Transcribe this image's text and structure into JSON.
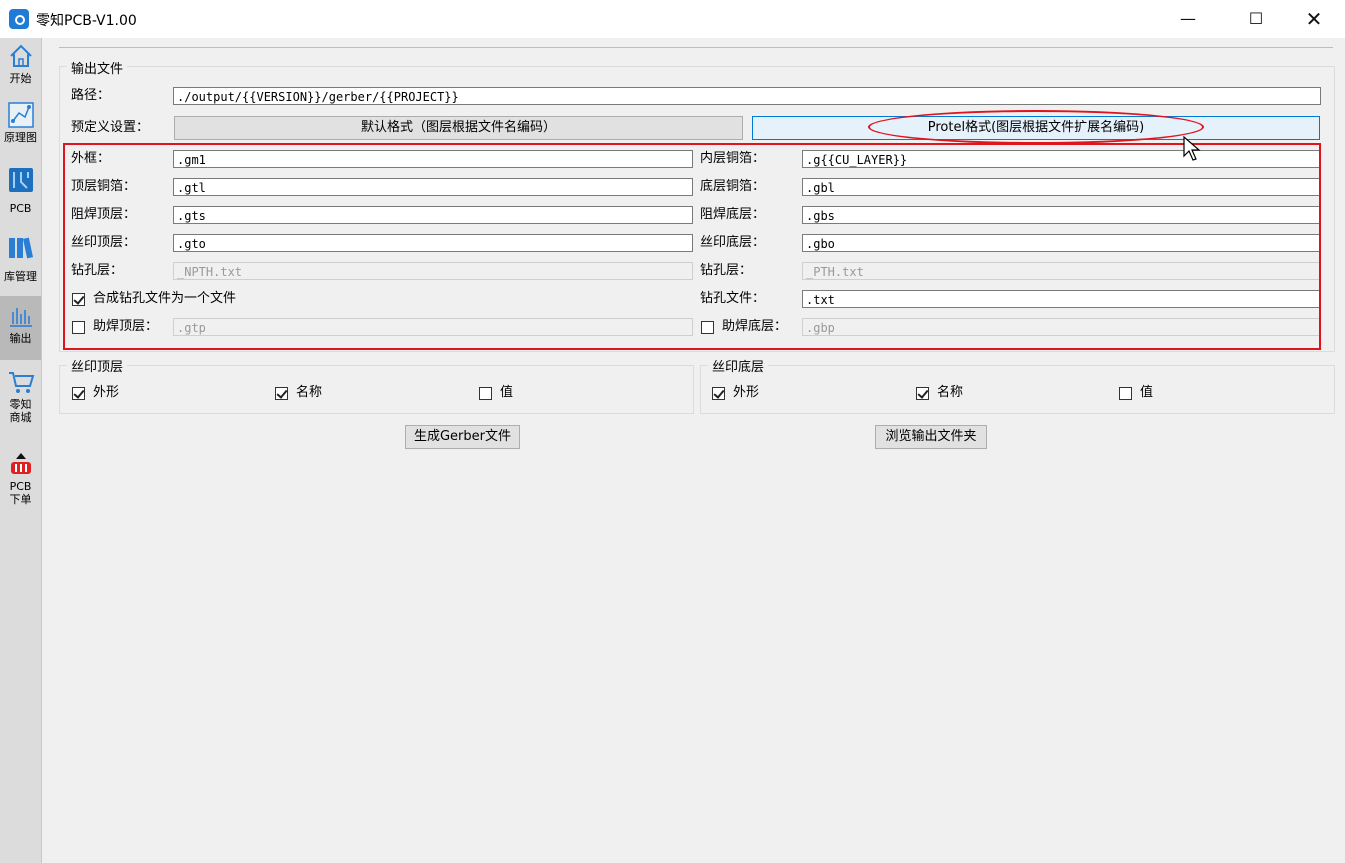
{
  "window": {
    "title": "零知PCB-V1.00",
    "minimize": "—",
    "maximize": "☐",
    "close": "✕"
  },
  "sidebar": {
    "items": [
      {
        "label": "开始",
        "icon": "home-icon"
      },
      {
        "label": "原理图",
        "icon": "schematic-icon"
      },
      {
        "label": "PCB",
        "icon": "pcb-icon"
      },
      {
        "label": "库管理",
        "icon": "library-icon"
      },
      {
        "label": "输出",
        "icon": "output-icon",
        "active": true
      },
      {
        "label": "零知商城",
        "label_line1": "零知",
        "label_line2": "商城",
        "icon": "cart-icon"
      },
      {
        "label": "PCB下单",
        "label_line1": "PCB",
        "label_line2": "下单",
        "icon": "order-icon"
      }
    ]
  },
  "output_files": {
    "group_title": "输出文件",
    "path_label": "路径：",
    "path_value": "./output/{{VERSION}}/gerber/{{PROJECT}}",
    "preset_label": "预定义设置：",
    "preset_default": "默认格式（图层根据文件名编码）",
    "preset_protel": "Protel格式(图层根据文件扩展名编码)",
    "fields": {
      "outline_label": "外框：",
      "outline_value": ".gm1",
      "inner_cu_label": "内层铜箔：",
      "inner_cu_value": ".g{{CU_LAYER}}",
      "top_cu_label": "顶层铜箔：",
      "top_cu_value": ".gtl",
      "bottom_cu_label": "底层铜箔：",
      "bottom_cu_value": ".gbl",
      "top_mask_label": "阻焊顶层：",
      "top_mask_value": ".gts",
      "bottom_mask_label": "阻焊底层：",
      "bottom_mask_value": ".gbs",
      "top_silk_label": "丝印顶层：",
      "top_silk_value": ".gto",
      "bottom_silk_label": "丝印底层：",
      "bottom_silk_value": ".gbo",
      "drill_npth_label": "钻孔层：",
      "drill_npth_value": "_NPTH.txt",
      "drill_pth_label": "钻孔层：",
      "drill_pth_value": "_PTH.txt",
      "merge_drill_label": "合成钻孔文件为一个文件",
      "merge_drill_checked": true,
      "drill_file_label": "钻孔文件：",
      "drill_file_value": ".txt",
      "top_paste_label": "助焊顶层：",
      "top_paste_value": ".gtp",
      "top_paste_checked": false,
      "bottom_paste_label": "助焊底层：",
      "bottom_paste_value": ".gbp",
      "bottom_paste_checked": false
    }
  },
  "silk_top": {
    "title": "丝印顶层",
    "shape_label": "外形",
    "shape_checked": true,
    "name_label": "名称",
    "name_checked": true,
    "value_label": "值",
    "value_checked": false
  },
  "silk_bottom": {
    "title": "丝印底层",
    "shape_label": "外形",
    "shape_checked": true,
    "name_label": "名称",
    "name_checked": true,
    "value_label": "值",
    "value_checked": false
  },
  "actions": {
    "generate": "生成Gerber文件",
    "browse": "浏览输出文件夹"
  },
  "colors": {
    "highlight": "#e0141e",
    "accent": "#0078d7",
    "sidebar_bg": "#dcdcdc"
  }
}
